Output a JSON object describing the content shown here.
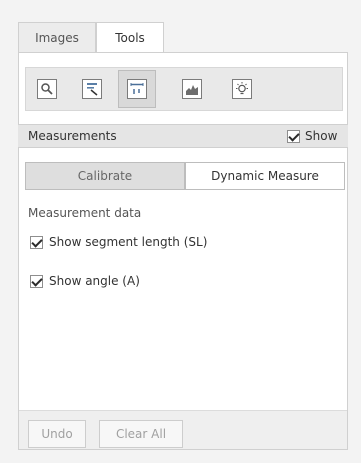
{
  "tabs": [
    {
      "label": "Images"
    },
    {
      "label": "Tools"
    }
  ],
  "toolbar": {
    "tools": [
      {
        "icon": "zoom-magnifier-icon"
      },
      {
        "icon": "annotation-icon"
      },
      {
        "icon": "measure-ruler-icon",
        "active": true
      },
      {
        "icon": "histogram-icon"
      },
      {
        "icon": "lightbulb-icon"
      }
    ]
  },
  "measurements": {
    "title": "Measurements",
    "show_label": "Show",
    "show_checked": true
  },
  "modes": {
    "calibrate_label": "Calibrate",
    "dynamic_label": "Dynamic Measure"
  },
  "measurement_data": {
    "heading": "Measurement data",
    "options": [
      {
        "label": "Show segment length (SL)",
        "checked": true
      },
      {
        "label": "Show angle (A)",
        "checked": true
      }
    ]
  },
  "actions": {
    "undo_label": "Undo",
    "clear_all_label": "Clear All"
  }
}
